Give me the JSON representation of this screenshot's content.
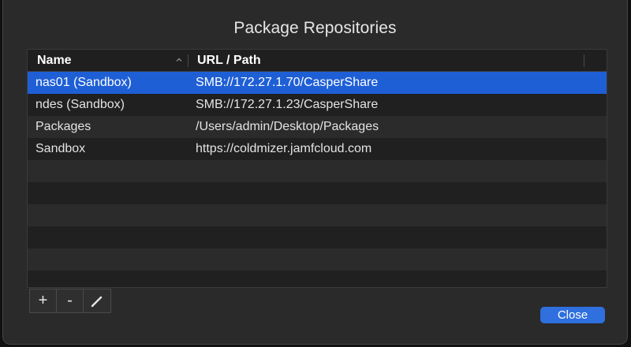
{
  "dialog": {
    "title": "Package Repositories"
  },
  "table": {
    "columns": {
      "name": "Name",
      "url": "URL / Path"
    },
    "rows": [
      {
        "name": "nas01 (Sandbox)",
        "url": "SMB://172.27.1.70/CasperShare",
        "selected": true
      },
      {
        "name": "ndes (Sandbox)",
        "url": "SMB://172.27.1.23/CasperShare",
        "selected": false
      },
      {
        "name": "Packages",
        "url": "/Users/admin/Desktop/Packages",
        "selected": false
      },
      {
        "name": "Sandbox",
        "url": "https://coldmizer.jamfcloud.com",
        "selected": false
      }
    ],
    "sort_icon": "chevron-up-icon"
  },
  "toolbar": {
    "add_label": "+",
    "remove_label": "-",
    "edit_icon": "pencil-icon"
  },
  "buttons": {
    "close_label": "Close"
  },
  "colors": {
    "accent": "#1f5fd6",
    "button_blue": "#2f6fde",
    "background": "#2a2a2a"
  }
}
